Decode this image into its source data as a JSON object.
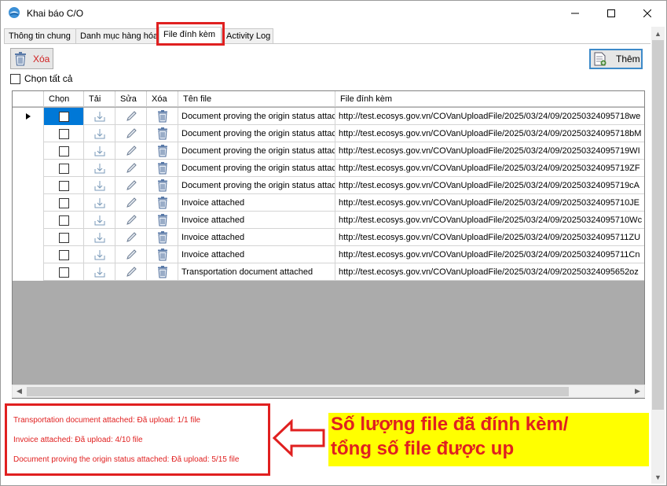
{
  "window": {
    "title": "Khai báo C/O"
  },
  "tabs": [
    {
      "label": "Thông tin chung"
    },
    {
      "label": "Danh mục hàng hóa"
    },
    {
      "label": "File đính kèm",
      "active": true
    },
    {
      "label": "Activity Log"
    }
  ],
  "toolbar": {
    "delete_label": "Xóa",
    "add_label": "Thêm",
    "select_all_label": "Chọn tất cả"
  },
  "grid": {
    "columns": [
      "Chọn",
      "Tải",
      "Sửa",
      "Xóa",
      "Tên file",
      "File đính kèm"
    ],
    "rows": [
      {
        "name": "Document proving the origin status attach...",
        "url": "http://test.ecosys.gov.vn/COVanUploadFile/2025/03/24/09/20250324095718we"
      },
      {
        "name": "Document proving the origin status attach...",
        "url": "http://test.ecosys.gov.vn/COVanUploadFile/2025/03/24/09/20250324095718bM"
      },
      {
        "name": "Document proving the origin status attach...",
        "url": "http://test.ecosys.gov.vn/COVanUploadFile/2025/03/24/09/20250324095719WI"
      },
      {
        "name": "Document proving the origin status attach...",
        "url": "http://test.ecosys.gov.vn/COVanUploadFile/2025/03/24/09/20250324095719ZF"
      },
      {
        "name": "Document proving the origin status attach...",
        "url": "http://test.ecosys.gov.vn/COVanUploadFile/2025/03/24/09/20250324095719cA"
      },
      {
        "name": "Invoice attached",
        "url": "http://test.ecosys.gov.vn/COVanUploadFile/2025/03/24/09/20250324095710JE"
      },
      {
        "name": "Invoice attached",
        "url": "http://test.ecosys.gov.vn/COVanUploadFile/2025/03/24/09/20250324095710Wc"
      },
      {
        "name": "Invoice attached",
        "url": "http://test.ecosys.gov.vn/COVanUploadFile/2025/03/24/09/20250324095711ZU"
      },
      {
        "name": "Invoice attached",
        "url": "http://test.ecosys.gov.vn/COVanUploadFile/2025/03/24/09/20250324095711Cn"
      },
      {
        "name": "Transportation document attached",
        "url": "http://test.ecosys.gov.vn/COVanUploadFile/2025/03/24/09/20250324095652oz"
      }
    ]
  },
  "status": {
    "lines": [
      "Transportation document attached: Đã upload: 1/1 file",
      "Invoice attached: Đã upload: 4/10 file",
      "Document proving the origin status attached: Đã upload: 5/15 file"
    ]
  },
  "callout": {
    "line1": "Số lượng file đã đính kèm/",
    "line2": "tổng số file được up"
  },
  "colors": {
    "highlight": "#e02020",
    "callout_bg": "#ffff00",
    "selected_cell": "#0078d7",
    "grid_empty": "#ababab"
  }
}
